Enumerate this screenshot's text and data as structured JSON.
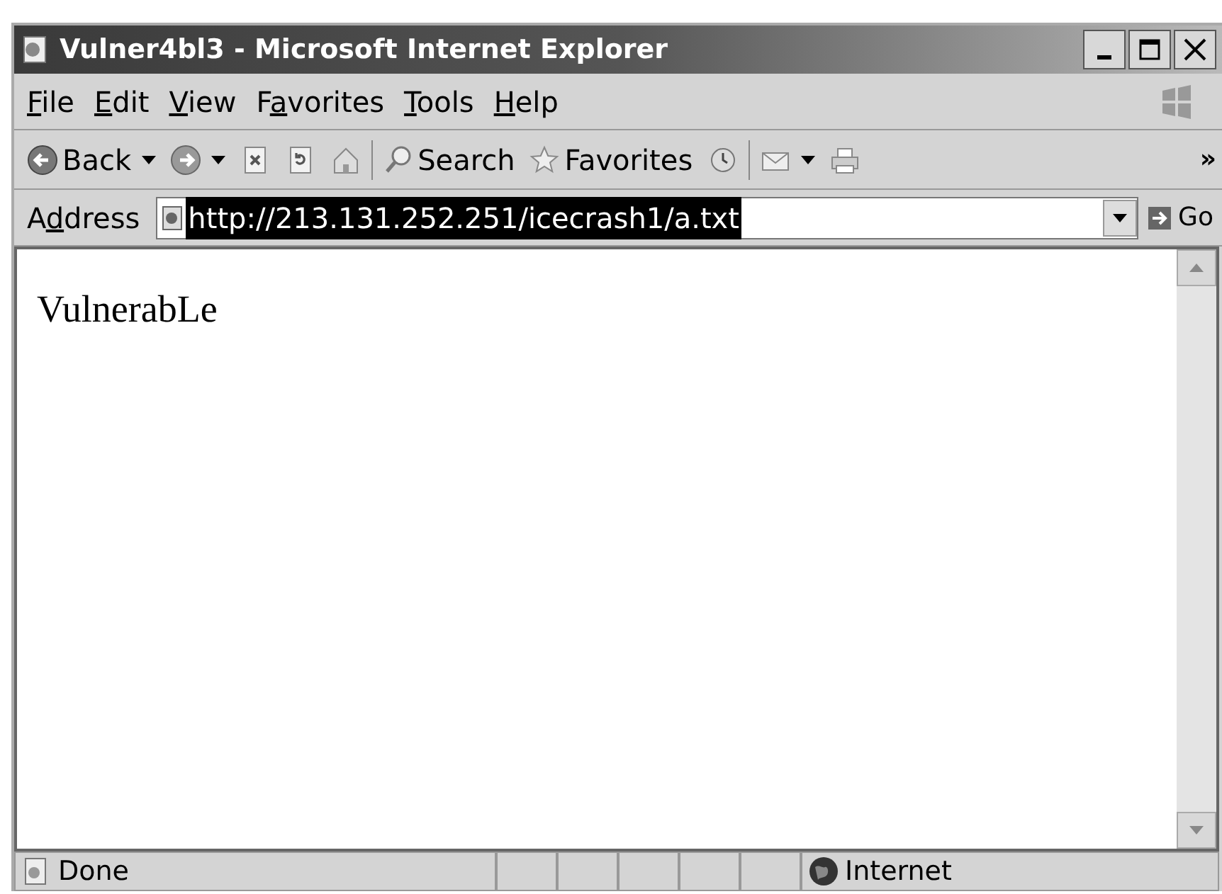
{
  "window": {
    "title": "Vulner4bl3 - Microsoft Internet Explorer",
    "controls": [
      {
        "kind": "minimize"
      },
      {
        "kind": "maximize"
      },
      {
        "kind": "close"
      }
    ]
  },
  "menu": [
    {
      "key": "F",
      "after": "ile"
    },
    {
      "key": "E",
      "after": "dit"
    },
    {
      "key": "V",
      "after": "iew"
    },
    {
      "before": "F",
      "key": "a",
      "after": "vorites"
    },
    {
      "key": "T",
      "after": "ools"
    },
    {
      "key": "H",
      "after": "elp"
    }
  ],
  "toolbar": [
    {
      "kind": "back",
      "label": "Back"
    },
    {
      "kind": "forward"
    },
    {
      "kind": "stop"
    },
    {
      "kind": "refresh"
    },
    {
      "kind": "home"
    },
    {
      "kind": "search",
      "label": "Search"
    },
    {
      "kind": "favorites",
      "label": "Favorites"
    },
    {
      "kind": "history"
    },
    {
      "kind": "mail"
    },
    {
      "kind": "print"
    }
  ],
  "toolbar_more": "»",
  "address": {
    "label": {
      "before": "A",
      "key": "d",
      "after": "dress"
    },
    "value": "http://213.131.252.251/icecrash1/a.txt",
    "selected": true,
    "go": "Go"
  },
  "content": {
    "text": "VulnerabLe"
  },
  "status_bar": {
    "text": "Done",
    "zone": "Internet"
  }
}
